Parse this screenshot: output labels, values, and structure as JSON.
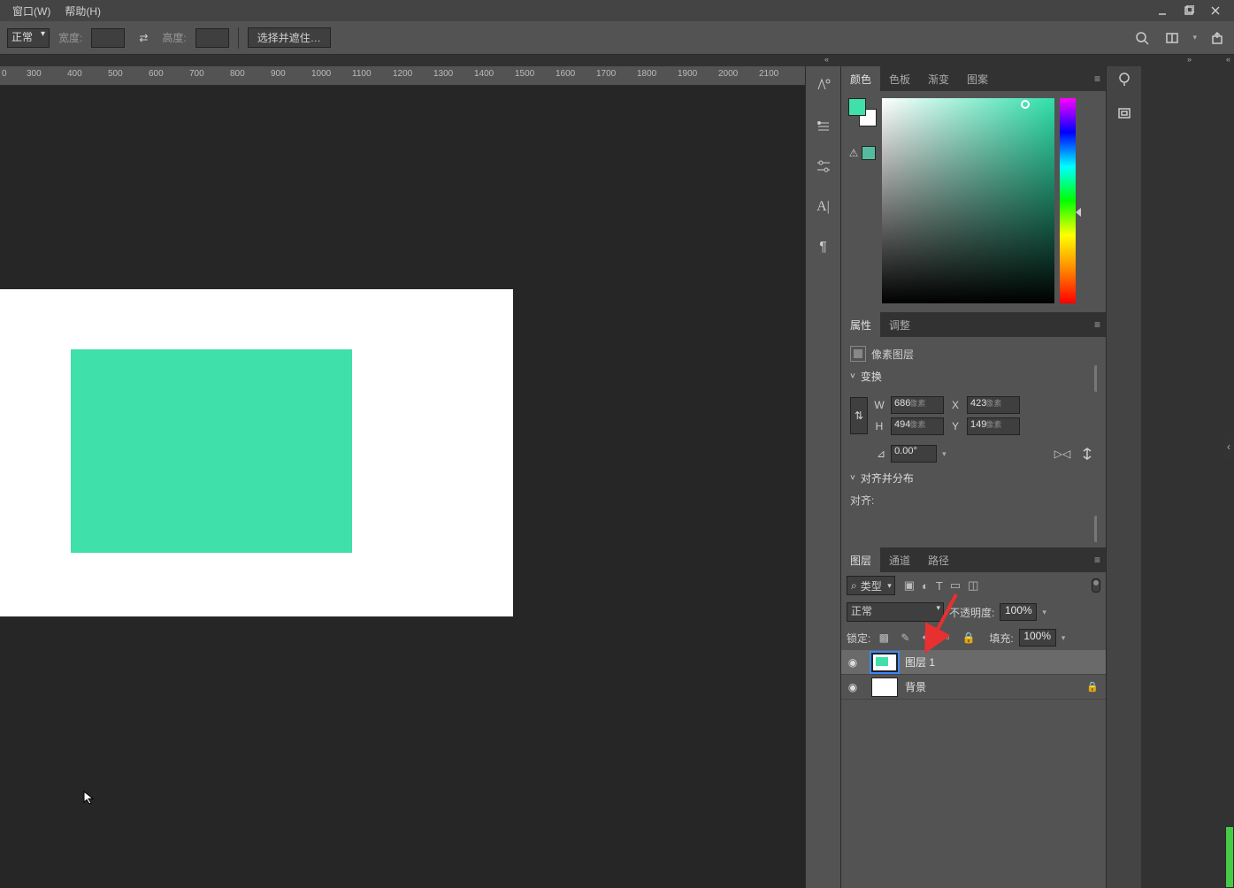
{
  "menubar": {
    "window": "窗口(W)",
    "help": "帮助(H)"
  },
  "options": {
    "blend": "正常",
    "width_label": "宽度:",
    "height_label": "高度:",
    "select_mask": "选择并遮住…"
  },
  "ruler": [
    "0",
    "300",
    "400",
    "500",
    "600",
    "700",
    "800",
    "900",
    "1000",
    "1100",
    "1200",
    "1300",
    "1400",
    "1500",
    "1600",
    "1700",
    "1800",
    "1900",
    "2000",
    "2100"
  ],
  "panels": {
    "color_tabs": [
      "颜色",
      "色板",
      "渐变",
      "图案"
    ],
    "props_tabs": [
      "属性",
      "调整"
    ],
    "layer_tabs": [
      "图层",
      "通道",
      "路径"
    ]
  },
  "colors": {
    "foreground": "#3fe0aa",
    "background": "#ffffff"
  },
  "properties": {
    "pixel_layer": "像素图层",
    "transform": "变换",
    "w_label": "W",
    "w_value": "686",
    "px": "像素",
    "h_label": "H",
    "h_value": "494",
    "x_label": "X",
    "x_value": "423",
    "y_label": "Y",
    "y_value": "149",
    "angle_value": "0.00°",
    "align_dist": "对齐并分布",
    "align_label": "对齐:"
  },
  "layers": {
    "kind": "类型",
    "blend": "正常",
    "opacity_label": "不透明度:",
    "opacity": "100%",
    "lock_label": "锁定:",
    "fill_label": "填充:",
    "fill": "100%",
    "items": [
      {
        "name": "图层 1",
        "selected": true,
        "thumb": "rect",
        "locked": false
      },
      {
        "name": "背景",
        "selected": false,
        "thumb": "white",
        "locked": true
      }
    ]
  }
}
